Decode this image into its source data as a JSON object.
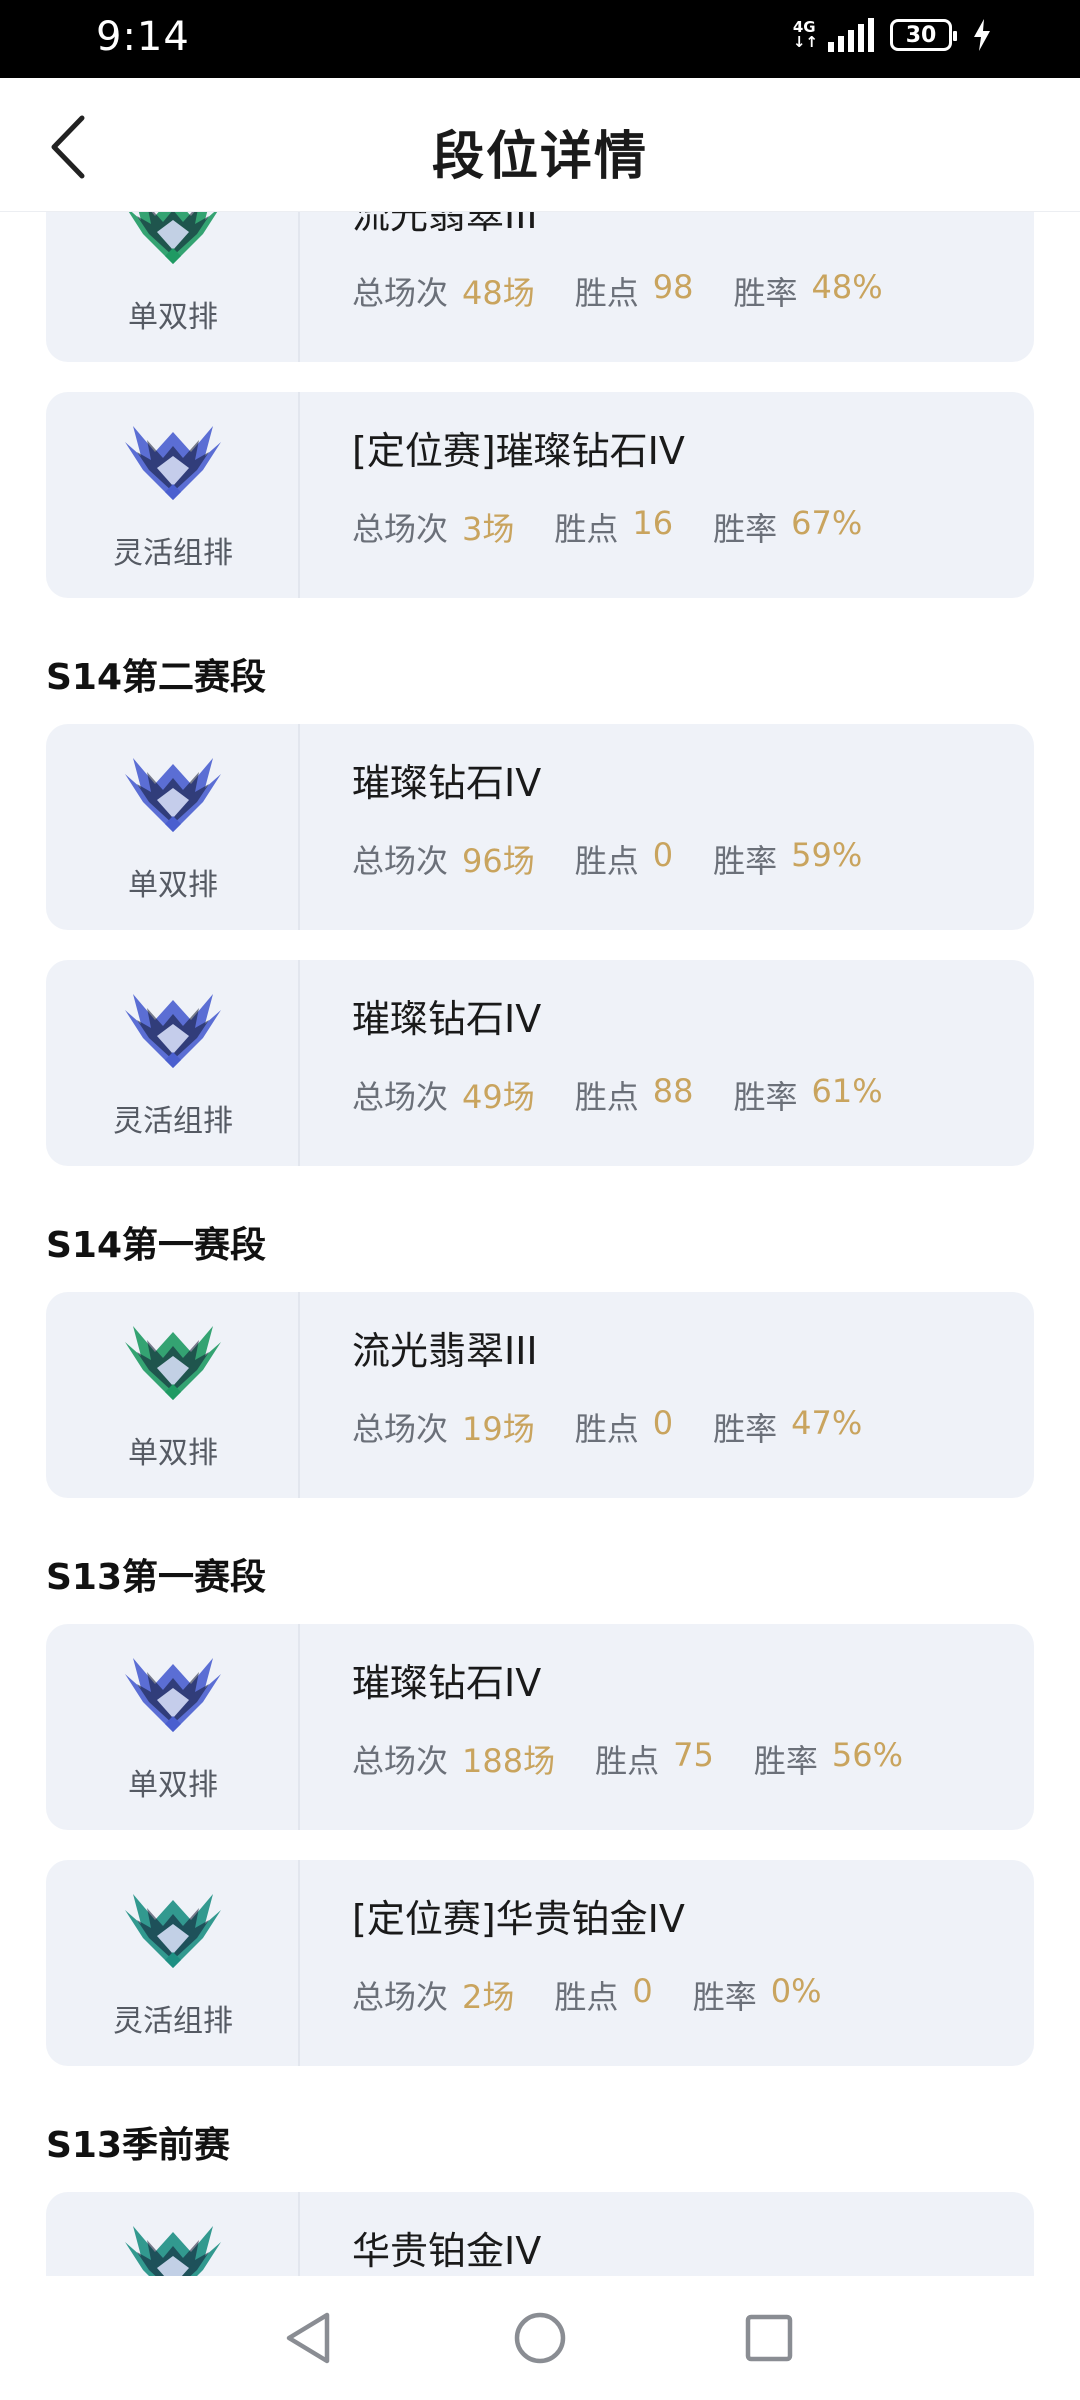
{
  "status": {
    "time": "9:14",
    "network": "4G",
    "battery": "30"
  },
  "header": {
    "title": "段位详情"
  },
  "icons": {
    "back": "back-arrow-icon",
    "emerald": "emerald-rank-emblem",
    "diamond": "diamond-rank-emblem",
    "platinum": "platinum-rank-emblem",
    "nav_back": "triangle-back-icon",
    "nav_home": "circle-home-icon",
    "nav_recents": "square-recents-icon"
  },
  "colors": {
    "card_bg": "#eff2f8",
    "stat_value": "#c9a45e",
    "emerald": "#1f9a63",
    "diamond": "#4a5fcf",
    "platinum": "#1d8f83"
  },
  "stat_labels": {
    "games": "总场次",
    "points": "胜点",
    "winrate": "胜率"
  },
  "sections": [
    {
      "title": "",
      "cards": [
        {
          "queue": "单双排",
          "rank": "流光翡翠III",
          "tier": "emerald",
          "games": "48场",
          "points": "98",
          "winrate": "48%"
        },
        {
          "queue": "灵活组排",
          "rank": "[定位赛]璀璨钻石IV",
          "tier": "diamond",
          "games": "3场",
          "points": "16",
          "winrate": "67%"
        }
      ]
    },
    {
      "title": "S14第二赛段",
      "cards": [
        {
          "queue": "单双排",
          "rank": "璀璨钻石IV",
          "tier": "diamond",
          "games": "96场",
          "points": "0",
          "winrate": "59%"
        },
        {
          "queue": "灵活组排",
          "rank": "璀璨钻石IV",
          "tier": "diamond",
          "games": "49场",
          "points": "88",
          "winrate": "61%"
        }
      ]
    },
    {
      "title": "S14第一赛段",
      "cards": [
        {
          "queue": "单双排",
          "rank": "流光翡翠III",
          "tier": "emerald",
          "games": "19场",
          "points": "0",
          "winrate": "47%"
        }
      ]
    },
    {
      "title": "S13第一赛段",
      "cards": [
        {
          "queue": "单双排",
          "rank": "璀璨钻石IV",
          "tier": "diamond",
          "games": "188场",
          "points": "75",
          "winrate": "56%"
        },
        {
          "queue": "灵活组排",
          "rank": "[定位赛]华贵铂金IV",
          "tier": "platinum",
          "games": "2场",
          "points": "0",
          "winrate": "0%"
        }
      ]
    },
    {
      "title": "S13季前赛",
      "cards": [
        {
          "queue": "",
          "rank": "华贵铂金IV",
          "tier": "platinum",
          "games": "",
          "points": "",
          "winrate": ""
        }
      ]
    }
  ]
}
